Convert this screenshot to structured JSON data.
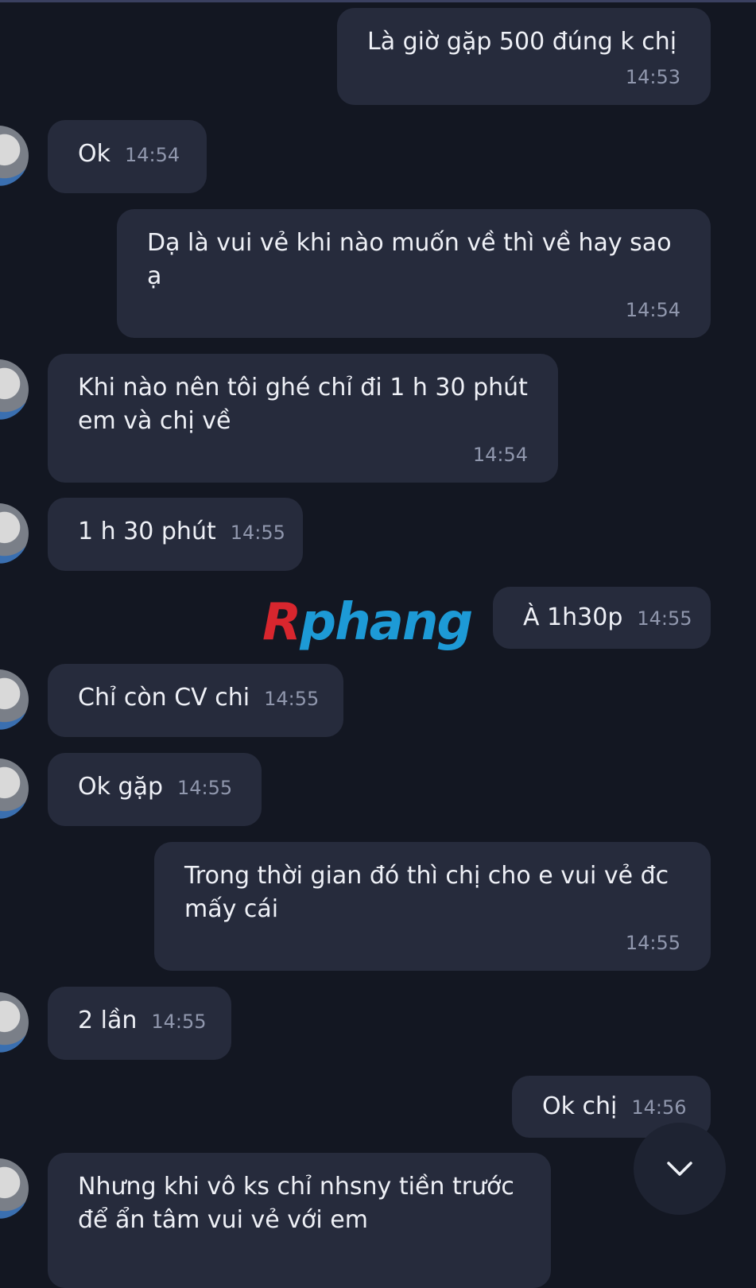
{
  "watermark": {
    "first": "R",
    "rest": "phang"
  },
  "messages": [
    {
      "side": "out",
      "text": "Là giờ gặp 500 đúng k chị",
      "time": "14:53"
    },
    {
      "side": "in",
      "text": "Ok",
      "time": "14:54"
    },
    {
      "side": "out",
      "text": "Dạ là vui vẻ khi nào muốn về thì về hay sao ạ",
      "time": "14:54"
    },
    {
      "side": "in",
      "text": "Khi nào nên tôi ghé chỉ đi 1 h 30 phút em và chị về",
      "time": "14:54"
    },
    {
      "side": "in",
      "text": "1 h 30 phút",
      "time": "14:55"
    },
    {
      "side": "out",
      "text": "À 1h30p",
      "time": "14:55"
    },
    {
      "side": "in",
      "text": "Chỉ còn CV chi",
      "time": "14:55"
    },
    {
      "side": "in",
      "text": "Ok gặp",
      "time": "14:55"
    },
    {
      "side": "out",
      "text": "Trong thời gian đó thì chị cho e vui vẻ đc mấy cái",
      "time": "14:55"
    },
    {
      "side": "in",
      "text": "2 lần",
      "time": "14:55"
    },
    {
      "side": "out",
      "text": "Ok chị",
      "time": "14:56"
    },
    {
      "side": "in",
      "text": "Nhưng khi vô ks chỉ nhsny tiền trước để ẩn tâm vui vẻ với em",
      "time": ""
    }
  ],
  "colors": {
    "background": "#131722",
    "bubble": "#262b3c",
    "timestamp": "#9097ad"
  },
  "icons": {
    "scroll_down": "chevron-down-icon"
  }
}
